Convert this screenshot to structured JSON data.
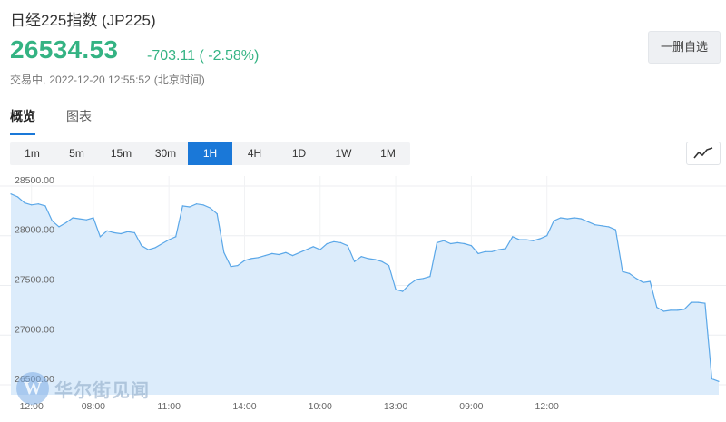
{
  "header": {
    "title": "日经225指数 (JP225)",
    "price": "26534.53",
    "change": "-703.11 ( -2.58%)",
    "status": "交易中,",
    "datetime": "2022-12-20 12:55:52",
    "timezone": "(北京时间)",
    "remove_label": "一删自选"
  },
  "colors": {
    "down": "#34b383",
    "accent": "#1a78d8",
    "line": "#5aa7e8",
    "fill": "#dcecfb"
  },
  "tabs": [
    {
      "label": "概览",
      "active": true
    },
    {
      "label": "图表",
      "active": false
    }
  ],
  "periods": [
    {
      "label": "1m",
      "active": false
    },
    {
      "label": "5m",
      "active": false
    },
    {
      "label": "15m",
      "active": false
    },
    {
      "label": "30m",
      "active": false
    },
    {
      "label": "1H",
      "active": true
    },
    {
      "label": "4H",
      "active": false
    },
    {
      "label": "1D",
      "active": false
    },
    {
      "label": "1W",
      "active": false
    },
    {
      "label": "1M",
      "active": false
    }
  ],
  "chart_type_icon": "line-chart-icon",
  "watermark": {
    "logo_letter": "W",
    "text": "华尔街见闻"
  },
  "chart_data": {
    "type": "area",
    "ylim": [
      26400,
      28600
    ],
    "y_ticks": [
      26500,
      27000,
      27500,
      28000,
      28500
    ],
    "y_tick_labels": [
      "26500.00",
      "27000.00",
      "27500.00",
      "28000.00",
      "28500.00"
    ],
    "x_tick_labels": [
      "12:00",
      "08:00",
      "11:00",
      "14:00",
      "10:00",
      "13:00",
      "09:00",
      "12:00"
    ],
    "x_tick_index": [
      3,
      12,
      23,
      34,
      45,
      56,
      67,
      78
    ],
    "values": [
      28420,
      28390,
      28330,
      28310,
      28320,
      28300,
      28150,
      28090,
      28130,
      28180,
      28170,
      28160,
      28180,
      27990,
      28050,
      28030,
      28020,
      28040,
      28030,
      27900,
      27860,
      27880,
      27920,
      27960,
      27990,
      28300,
      28290,
      28320,
      28310,
      28280,
      28220,
      27830,
      27690,
      27700,
      27750,
      27770,
      27780,
      27800,
      27820,
      27810,
      27830,
      27800,
      27830,
      27860,
      27890,
      27860,
      27920,
      27940,
      27930,
      27900,
      27740,
      27790,
      27770,
      27760,
      27740,
      27700,
      27460,
      27440,
      27510,
      27560,
      27570,
      27590,
      27930,
      27950,
      27920,
      27930,
      27920,
      27900,
      27820,
      27840,
      27840,
      27860,
      27870,
      27990,
      27960,
      27960,
      27950,
      27970,
      28000,
      28150,
      28180,
      28170,
      28180,
      28170,
      28140,
      28110,
      28100,
      28090,
      28060,
      27640,
      27620,
      27570,
      27530,
      27540,
      27280,
      27240,
      27250,
      27250,
      27260,
      27330,
      27330,
      27320,
      26560,
      26534.53
    ]
  }
}
